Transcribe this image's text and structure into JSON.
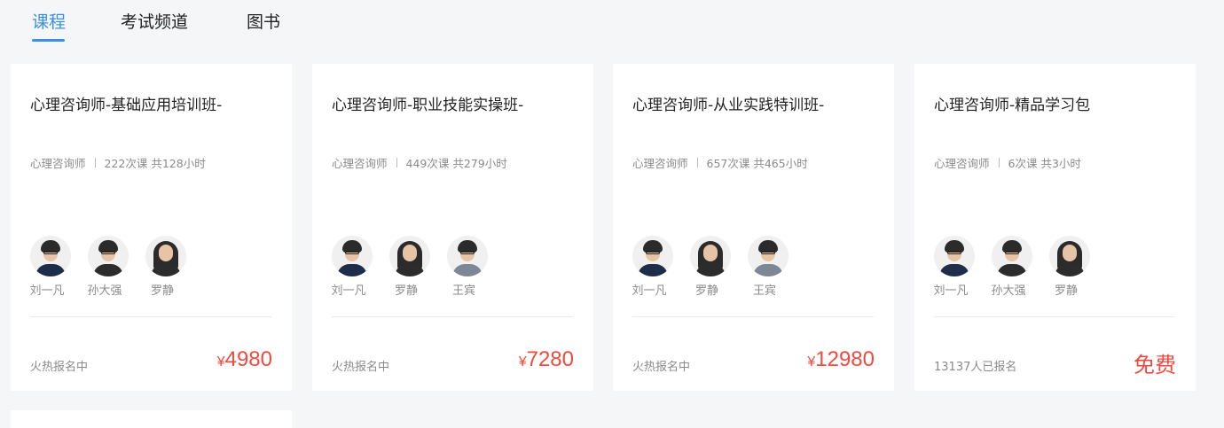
{
  "tabs": [
    {
      "label": "课程",
      "active": true
    },
    {
      "label": "考试频道",
      "active": false
    },
    {
      "label": "图书",
      "active": false
    }
  ],
  "colors": {
    "accent": "#3c8fe8",
    "price": "#f04a3e",
    "background": "#f5f6f8"
  },
  "cards": [
    {
      "title": "心理咨询师-基础应用培训班-",
      "category": "心理咨询师",
      "stats": "222次课 共128小时",
      "teachers": [
        {
          "name": "刘一凡",
          "icon": "teacher-avatar"
        },
        {
          "name": "孙大强",
          "icon": "teacher-avatar"
        },
        {
          "name": "罗静",
          "icon": "teacher-avatar"
        }
      ],
      "status": "火热报名中",
      "price_symbol": "¥",
      "price": "4980"
    },
    {
      "title": "心理咨询师-职业技能实操班-",
      "category": "心理咨询师",
      "stats": "449次课 共279小时",
      "teachers": [
        {
          "name": "刘一凡",
          "icon": "teacher-avatar"
        },
        {
          "name": "罗静",
          "icon": "teacher-avatar"
        },
        {
          "name": "王宾",
          "icon": "teacher-avatar"
        }
      ],
      "status": "火热报名中",
      "price_symbol": "¥",
      "price": "7280"
    },
    {
      "title": "心理咨询师-从业实践特训班-",
      "category": "心理咨询师",
      "stats": "657次课 共465小时",
      "teachers": [
        {
          "name": "刘一凡",
          "icon": "teacher-avatar"
        },
        {
          "name": "罗静",
          "icon": "teacher-avatar"
        },
        {
          "name": "王宾",
          "icon": "teacher-avatar"
        }
      ],
      "status": "火热报名中",
      "price_symbol": "¥",
      "price": "12980"
    },
    {
      "title": "心理咨询师-精品学习包",
      "category": "心理咨询师",
      "stats": "6次课 共3小时",
      "teachers": [
        {
          "name": "刘一凡",
          "icon": "teacher-avatar"
        },
        {
          "name": "孙大强",
          "icon": "teacher-avatar"
        },
        {
          "name": "罗静",
          "icon": "teacher-avatar"
        }
      ],
      "status": "13137人已报名",
      "price_free": "免费"
    }
  ]
}
